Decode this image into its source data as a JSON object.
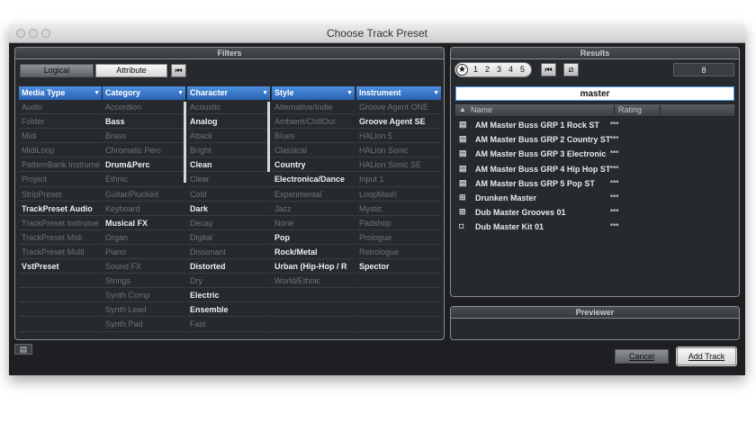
{
  "window": {
    "title": "Choose Track Preset"
  },
  "filters": {
    "title": "Filters",
    "logical_label": "Logical",
    "attribute_label": "Attribute",
    "reset_icon": "rewind-reset-icon",
    "columns": [
      {
        "header": "Media Type",
        "items": [
          {
            "label": "Audio",
            "on": false
          },
          {
            "label": "Folder",
            "on": false
          },
          {
            "label": "Midi",
            "on": false
          },
          {
            "label": "MidiLoop",
            "on": false
          },
          {
            "label": "PatternBank Instrume",
            "on": false
          },
          {
            "label": "Project",
            "on": false
          },
          {
            "label": "StripPreset",
            "on": false
          },
          {
            "label": "TrackPreset Audio",
            "on": true
          },
          {
            "label": "TrackPreset Instrume",
            "on": false
          },
          {
            "label": "TrackPreset Midi",
            "on": false
          },
          {
            "label": "TrackPreset Multi",
            "on": false
          },
          {
            "label": "VstPreset",
            "on": true
          },
          {
            "label": "",
            "on": false
          },
          {
            "label": "",
            "on": false
          },
          {
            "label": "",
            "on": false
          },
          {
            "label": "",
            "on": false
          }
        ]
      },
      {
        "header": "Category",
        "items": [
          {
            "label": "Accordion",
            "on": false
          },
          {
            "label": "Bass",
            "on": true
          },
          {
            "label": "Brass",
            "on": false
          },
          {
            "label": "Chromatic Perc",
            "on": false
          },
          {
            "label": "Drum&Perc",
            "on": true
          },
          {
            "label": "Ethnic",
            "on": false
          },
          {
            "label": "Guitar/Plucked",
            "on": false
          },
          {
            "label": "Keyboard",
            "on": false
          },
          {
            "label": "Musical FX",
            "on": true
          },
          {
            "label": "Organ",
            "on": false
          },
          {
            "label": "Piano",
            "on": false
          },
          {
            "label": "Sound FX",
            "on": false
          },
          {
            "label": "Strings",
            "on": false
          },
          {
            "label": "Synth Comp",
            "on": false
          },
          {
            "label": "Synth Lead",
            "on": false
          },
          {
            "label": "Synth Pad",
            "on": false
          }
        ]
      },
      {
        "header": "Character",
        "items": [
          {
            "label": "Acoustic",
            "on": false
          },
          {
            "label": "Analog",
            "on": true
          },
          {
            "label": "Attack",
            "on": false
          },
          {
            "label": "Bright",
            "on": false
          },
          {
            "label": "Clean",
            "on": true
          },
          {
            "label": "Clear",
            "on": false
          },
          {
            "label": "Cold",
            "on": false
          },
          {
            "label": "Dark",
            "on": true
          },
          {
            "label": "Decay",
            "on": false
          },
          {
            "label": "Digital",
            "on": false
          },
          {
            "label": "Dissonant",
            "on": false
          },
          {
            "label": "Distorted",
            "on": true
          },
          {
            "label": "Dry",
            "on": false
          },
          {
            "label": "Electric",
            "on": true
          },
          {
            "label": "Ensemble",
            "on": true
          },
          {
            "label": "Fast",
            "on": false
          }
        ]
      },
      {
        "header": "Style",
        "items": [
          {
            "label": "Alternative/Indie",
            "on": false
          },
          {
            "label": "Ambient/ChillOut",
            "on": false
          },
          {
            "label": "Blues",
            "on": false
          },
          {
            "label": "Classical",
            "on": false
          },
          {
            "label": "Country",
            "on": true
          },
          {
            "label": "Electronica/Dance",
            "on": true
          },
          {
            "label": "Experimental",
            "on": false
          },
          {
            "label": "Jazz",
            "on": false
          },
          {
            "label": "None",
            "on": false
          },
          {
            "label": "Pop",
            "on": true
          },
          {
            "label": "Rock/Metal",
            "on": true
          },
          {
            "label": "Urban (Hip-Hop / R",
            "on": true
          },
          {
            "label": "World/Ethnic",
            "on": false
          },
          {
            "label": "",
            "on": false
          },
          {
            "label": "",
            "on": false
          },
          {
            "label": "",
            "on": false
          }
        ]
      },
      {
        "header": "Instrument",
        "items": [
          {
            "label": "Groove Agent ONE",
            "on": false
          },
          {
            "label": "Groove Agent SE",
            "on": true
          },
          {
            "label": "HALion 5",
            "on": false
          },
          {
            "label": "HALion Sonic",
            "on": false
          },
          {
            "label": "HALion Sonic SE",
            "on": false
          },
          {
            "label": "Input 1",
            "on": false
          },
          {
            "label": "LoopMash",
            "on": false
          },
          {
            "label": "Mystic",
            "on": false
          },
          {
            "label": "Padshop",
            "on": false
          },
          {
            "label": "Prologue",
            "on": false
          },
          {
            "label": "Retrologue",
            "on": false
          },
          {
            "label": "Spector",
            "on": true
          },
          {
            "label": "",
            "on": false
          },
          {
            "label": "",
            "on": false
          },
          {
            "label": "",
            "on": false
          },
          {
            "label": "",
            "on": false
          }
        ]
      }
    ]
  },
  "results": {
    "title": "Results",
    "rating_filter": [
      "★",
      "1",
      "2",
      "3",
      "4",
      "5"
    ],
    "count": "8",
    "search_value": "master",
    "col_name": "Name",
    "col_rating": "Rating",
    "rows": [
      {
        "icon": "track-preset-icon",
        "name": "AM Master Buss GRP 1 Rock ST",
        "rating": "***"
      },
      {
        "icon": "track-preset-icon",
        "name": "AM Master Buss GRP 2 Country ST",
        "rating": "***"
      },
      {
        "icon": "track-preset-icon",
        "name": "AM Master Buss GRP 3 Electronic",
        "rating": "***"
      },
      {
        "icon": "track-preset-icon",
        "name": "AM Master Buss GRP 4 Hip Hop ST",
        "rating": "***"
      },
      {
        "icon": "track-preset-icon",
        "name": "AM Master Buss GRP 5 Pop ST",
        "rating": "***"
      },
      {
        "icon": "multi-track-icon",
        "name": "Drunken  Master",
        "rating": "***"
      },
      {
        "icon": "multi-track-icon",
        "name": "Dub Master Grooves 01",
        "rating": "***"
      },
      {
        "icon": "instrument-preset-icon",
        "name": "Dub Master Kit 01",
        "rating": "***"
      }
    ]
  },
  "previewer": {
    "title": "Previewer"
  },
  "footer": {
    "cancel_label": "Cancel",
    "add_label": "Add Track"
  }
}
